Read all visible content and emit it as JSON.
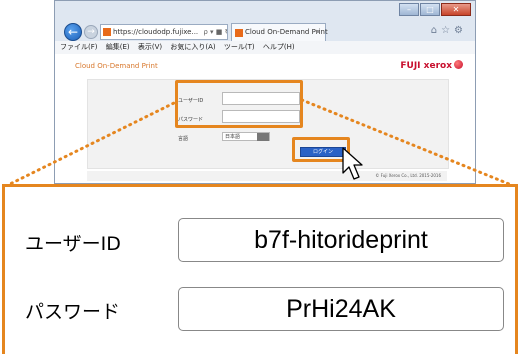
{
  "browser": {
    "address_text": "https://cloudodp.fujixe...",
    "address_icons": "ρ ▾ ■ ↻",
    "tab_title": "Cloud On-Demand Print",
    "tab_close": "×",
    "toolbar_icons": "⌂☆⚙",
    "win_minimize": "–",
    "win_maximize": "□",
    "win_close": "✕",
    "back_glyph": "←",
    "forward_glyph": "→",
    "menus": [
      "ファイル(F)",
      "編集(E)",
      "表示(V)",
      "お気に入り(A)",
      "ツール(T)",
      "ヘルプ(H)"
    ]
  },
  "page": {
    "title": "Cloud On-Demand Print",
    "brand": "FUJI xerox",
    "labels": {
      "user_id": "ユーザーID",
      "password": "パスワード",
      "language": "言語"
    },
    "language_value": "日本語",
    "login_button": "ログイン",
    "copyright": "© Fuji Xerox Co., Ltd. 2015-2016"
  },
  "zoom": {
    "user_id_label": "ユーザーID",
    "user_id_value": "b7f-hitorideprint",
    "password_label": "パスワード",
    "password_value": "PrHi24AK"
  },
  "colors": {
    "highlight": "#e5861f",
    "login_button": "#2a62c6",
    "brand": "#c8102e",
    "title": "#d8792f"
  },
  "icons": [
    "back-arrow-icon",
    "forward-arrow-icon",
    "search-icon",
    "refresh-icon",
    "home-icon",
    "star-icon",
    "gear-icon",
    "mouse-cursor-icon"
  ]
}
